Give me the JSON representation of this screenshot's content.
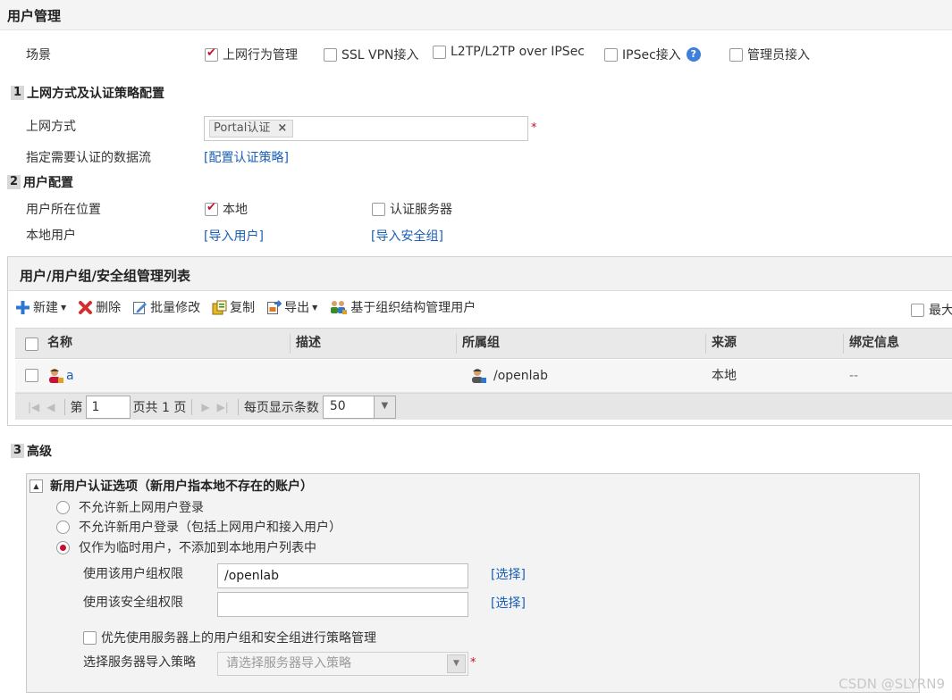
{
  "page": {
    "title": "用户管理"
  },
  "scenario": {
    "label": "场景",
    "options": [
      {
        "label": "上网行为管理",
        "checked": true
      },
      {
        "label": "SSL VPN接入",
        "checked": false
      },
      {
        "label": "L2TP/L2TP over IPSec",
        "checked": false
      },
      {
        "label": "IPSec接入",
        "checked": false,
        "help": "?"
      },
      {
        "label": "管理员接入",
        "checked": false
      }
    ]
  },
  "section1": {
    "number": "1",
    "title": "上网方式及认证策略配置",
    "access_method_label": "上网方式",
    "access_method_tag": "Portal认证",
    "tag_remove": "×",
    "required_mark": "*",
    "flow_label": "指定需要认证的数据流",
    "flow_link": "[配置认证策略]"
  },
  "section2": {
    "number": "2",
    "title": "用户配置",
    "location_label": "用户所在位置",
    "location_options": [
      {
        "label": "本地",
        "checked": true
      },
      {
        "label": "认证服务器",
        "checked": false
      }
    ],
    "local_user_label": "本地用户",
    "import_user_link": "[导入用户]",
    "import_group_link": "[导入安全组]"
  },
  "user_list": {
    "title": "用户/用户组/安全组管理列表",
    "toolbar": {
      "new": "新建",
      "delete": "删除",
      "batch_edit": "批量修改",
      "copy": "复制",
      "export": "导出",
      "org_manage": "基于组织结构管理用户",
      "max_label": "最大"
    },
    "columns": [
      "名称",
      "描述",
      "所属组",
      "来源",
      "绑定信息"
    ],
    "rows": [
      {
        "name": "a",
        "description": "",
        "group": "/openlab",
        "source": "本地",
        "binding": "--"
      }
    ],
    "pager": {
      "page_prefix": "第",
      "page_value": "1",
      "page_total": "页共 1 页",
      "per_page_label": "每页显示条数",
      "per_page_value": "50"
    }
  },
  "section3": {
    "number": "3",
    "title": "高级",
    "box_title": "新用户认证选项（新用户指本地不存在的账户）",
    "radios": [
      {
        "label": "不允许新上网用户登录",
        "selected": false
      },
      {
        "label": "不允许新用户登录（包括上网用户和接入用户）",
        "selected": false
      },
      {
        "label": "仅作为临时用户，不添加到本地用户列表中",
        "selected": true
      }
    ],
    "user_group_label": "使用该用户组权限",
    "user_group_value": "/openlab",
    "security_group_label": "使用该安全组权限",
    "security_group_value": "",
    "select_link": "[选择]",
    "prefer_server_label": "优先使用服务器上的用户组和安全组进行策略管理",
    "prefer_server_checked": false,
    "import_policy_label": "选择服务器导入策略",
    "import_policy_placeholder": "请选择服务器导入策略",
    "required_mark": "*"
  },
  "watermark": "CSDN @SLYRN9",
  "colors": {
    "accent_red": "#c8102e",
    "link_blue": "#1a5fb4"
  }
}
